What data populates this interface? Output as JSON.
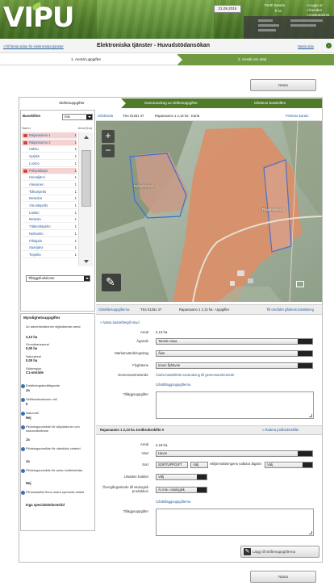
{
  "header": {
    "logo": "VIPU",
    "date": "21.05.2015",
    "user_name": "Perttl Savela",
    "user_sub": "fi-sv",
    "links": [
      "»Logga ut",
      "»Ärenden",
      "»Användarinst"
    ],
    "accent_color": "#4f7a2a"
  },
  "subheader": {
    "back_link": "«Till första sidan för elektroniska tjänster",
    "title": "Elektroniska tjänster  -  Huvudstödansökan",
    "next_link": "Nästa sida",
    "next_icon": "arrow-right-icon"
  },
  "steps": {
    "step1": "1. Anmäl uppgifter",
    "step2": "2. Ansök om stöd"
  },
  "buttons": {
    "top": "Nästa",
    "bottom": "Nästa",
    "save": "Lägg till skiftesuppgifterna"
  },
  "tabs": [
    "Skiftesuppgifter",
    "Sammandrag av skiftesuppgifter",
    "Gårdens basskiften"
  ],
  "left": {
    "filter_label": "Basskiften",
    "filter_value": "Inte",
    "col_name": "Namn",
    "col_count": "Areal (ha)",
    "items": [
      {
        "name": "Raijansuimo 1",
        "count": "1",
        "selected": true
      },
      {
        "name": "Raijansuimo 2",
        "count": "1",
        "selected": true
      },
      {
        "name": "Hakku",
        "count": "1",
        "selected": false
      },
      {
        "name": "Syrjälä",
        "count": "1",
        "selected": false
      },
      {
        "name": "Luomo",
        "count": "1",
        "selected": false
      },
      {
        "name": "Pohjoiskorpi",
        "count": "1",
        "selected": true
      },
      {
        "name": "Humaljärvi",
        "count": "1",
        "selected": false
      },
      {
        "name": "Alavainen",
        "count": "1",
        "selected": false
      },
      {
        "name": "Tolkanpelto",
        "count": "1",
        "selected": false
      },
      {
        "name": "Metsolat",
        "count": "1",
        "selected": false
      },
      {
        "name": "Ala-aitapelto",
        "count": "1",
        "selected": false
      },
      {
        "name": "Laidun",
        "count": "1",
        "selected": false
      },
      {
        "name": "Metsola",
        "count": "1",
        "selected": false
      },
      {
        "name": "Yläkenttäpelto",
        "count": "1",
        "selected": false
      },
      {
        "name": "Notkoelto",
        "count": "1",
        "selected": false
      },
      {
        "name": "Pihlajala",
        "count": "1",
        "selected": false
      },
      {
        "name": "Saarijärvi",
        "count": "1",
        "selected": false
      },
      {
        "name": "Tiepelto",
        "count": "1",
        "selected": false
      }
    ],
    "bottom_select": "Tilläggsfunktioner"
  },
  "myndighet": {
    "title": "Myndighetsuppgifter",
    "rows": [
      {
        "label": "Av administrationen digitaliserad areal",
        "value": "2,13 ha"
      },
      {
        "label": "Grundkartsareal",
        "value": "0,00 ha"
      },
      {
        "label": "Naturareal",
        "value": "0,00 ha"
      },
      {
        "label": "Stödregion",
        "value": "C1-område"
      }
    ],
    "info_rows": [
      {
        "label": "Ersättningsberättigande",
        "value": "Ja"
      },
      {
        "label": "Skiftessituationen vall",
        "value": "0"
      },
      {
        "label": "Naturvall",
        "value": "Nej"
      },
      {
        "label": "Pilotningsområde för alkyldidoner och nasunväxtämne",
        "value": "Ja"
      },
      {
        "label": "Pilotningsområde för växtdäck vinterid",
        "value": "Ja"
      },
      {
        "label": "Pilotningsområde för ackru kulthhstödar",
        "value": "Nej"
      },
      {
        "label": "På basskiftet finns andra speciella stödel",
        "value": "Inga specialstödsområd"
      }
    ]
  },
  "map_bar": {
    "link": "Gårdssida",
    "ref": "TS4 01251 47",
    "title": "Rapanaumo  1  2,13 ha - Karta",
    "right_link": "Förstora kartan"
  },
  "map": {
    "labels": [
      "Pohjoiskorpi",
      "Raijansuimo 2"
    ],
    "zoom_in": "+",
    "zoom_out": "−",
    "tool_icon": "wrench-icon"
  },
  "upp_bar": {
    "link": "Gåskiftesuppgifterna",
    "ref": "TS4 01251 47",
    "title": "Rapanaumo  1  2,13 ha - Uppgifter",
    "right_link": "Till området gårdens basiskning"
  },
  "upp": {
    "heading_link": "» Nästa basskiftetgift skyd",
    "areal_label": "Areal",
    "areal_value": "2,13 ha",
    "agande_label": "Ägande",
    "agande_value": "Tamsin ösua",
    "mark_label": "Markanvändningsslag",
    "mark_value": "Åker",
    "flyg_label": "Flyghävne",
    "flyg_value": "Innen flyhävne",
    "gem_label": "Gemensamhetsrubr",
    "gem_link": "Ändra basskiftets användning till gemensamhetsrubr",
    "gem_link2": "Gårdtilläggsuppgifterna",
    "till_label": "Tilläggsuppgifter"
  },
  "sk_bar": {
    "title": "Rapanaumo 1  2,13 ha  Jordbruksskifte A",
    "right_link": "» Radera jordbruksskifte"
  },
  "sk": {
    "areal_label": "Areal",
    "areal_value": "2,19  ha",
    "vaxt_label": "Växt",
    "vaxt_value": "Havre",
    "sort_label": "Sort",
    "sort_value": "SORTUPPGIFT",
    "sort_select": "Välj",
    "miljo_label": "Miljöersättningens valbara åtgärd",
    "miljo_value": "Välj",
    "utsades_label": "Utsädes kvalitet",
    "utsades_value": "Välj",
    "over_label": "Övergångsskede till ekologisk produktion",
    "over_value": "Är inte i ekologisk",
    "link": "Gårdtilläggsuppgifterna",
    "till_label": "Tilläggsuppgifter"
  }
}
